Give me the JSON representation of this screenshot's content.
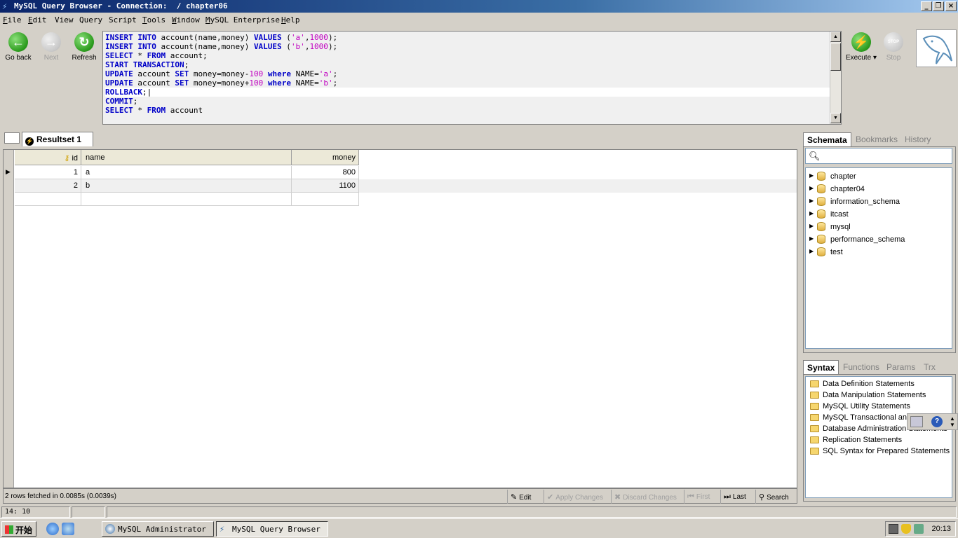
{
  "window": {
    "title": "MySQL Query Browser - Connection:  / chapter06"
  },
  "menu": {
    "items": [
      {
        "ul": "F",
        "rest": "ile"
      },
      {
        "ul": "E",
        "rest": "dit"
      },
      {
        "ul": "",
        "rest": "View"
      },
      {
        "ul": "",
        "rest": "Query"
      },
      {
        "ul": "",
        "rest": "Script"
      },
      {
        "ul": "T",
        "rest": "ools"
      },
      {
        "ul": "W",
        "rest": "indow"
      },
      {
        "ul": "M",
        "rest": "ySQL Enterprise"
      },
      {
        "ul": "H",
        "rest": "elp"
      }
    ]
  },
  "toolbar": {
    "go_back": "Go back",
    "next": "Next",
    "refresh": "Refresh",
    "execute": "Execute",
    "stop": "Stop"
  },
  "editor": {
    "lines": [
      [
        [
          "kw",
          "INSERT INTO"
        ],
        [
          "t",
          " account(name,money) "
        ],
        [
          "kw",
          "VALUES"
        ],
        [
          "t",
          " ("
        ],
        [
          "str",
          "'a'"
        ],
        [
          "t",
          ","
        ],
        [
          "num",
          "1000"
        ],
        [
          "t",
          ");"
        ]
      ],
      [
        [
          "kw",
          "INSERT INTO"
        ],
        [
          "t",
          " account(name,money) "
        ],
        [
          "kw",
          "VALUES"
        ],
        [
          "t",
          " ("
        ],
        [
          "str",
          "'b'"
        ],
        [
          "t",
          ","
        ],
        [
          "num",
          "1000"
        ],
        [
          "t",
          ");"
        ]
      ],
      [
        [
          "kw",
          "SELECT"
        ],
        [
          "t",
          " * "
        ],
        [
          "kw",
          "FROM"
        ],
        [
          "t",
          " account;"
        ]
      ],
      [
        [
          "kw",
          "START TRANSACTION"
        ],
        [
          "t",
          ";"
        ]
      ],
      [
        [
          "kw",
          "UPDATE"
        ],
        [
          "t",
          " account "
        ],
        [
          "kw",
          "SET"
        ],
        [
          "t",
          " money=money-"
        ],
        [
          "num",
          "100"
        ],
        [
          "t",
          " "
        ],
        [
          "kw",
          "where"
        ],
        [
          "t",
          " NAME="
        ],
        [
          "str",
          "'a'"
        ],
        [
          "t",
          ";"
        ]
      ],
      [
        [
          "kw",
          "UPDATE"
        ],
        [
          "t",
          " account "
        ],
        [
          "kw",
          "SET"
        ],
        [
          "t",
          " money=money+"
        ],
        [
          "num",
          "100"
        ],
        [
          "t",
          " "
        ],
        [
          "kw",
          "where"
        ],
        [
          "t",
          " NAME="
        ],
        [
          "str",
          "'b'"
        ],
        [
          "t",
          ";"
        ]
      ],
      [
        [
          "kw",
          "ROLLBACK"
        ],
        [
          "t",
          ";|"
        ]
      ],
      [
        [
          "kw",
          "COMMIT"
        ],
        [
          "t",
          ";"
        ]
      ],
      [
        [
          "kw",
          "SELECT"
        ],
        [
          "t",
          " * "
        ],
        [
          "kw",
          "FROM"
        ],
        [
          "t",
          " account"
        ]
      ]
    ],
    "current_line": 6
  },
  "results": {
    "tab_label": "Resultset 1",
    "columns": [
      {
        "label": "id",
        "align": "right",
        "key": true
      },
      {
        "label": "name",
        "align": "left"
      },
      {
        "label": "money",
        "align": "right"
      }
    ],
    "rows": [
      [
        "1",
        "a",
        "800"
      ],
      [
        "2",
        "b",
        "1100"
      ]
    ],
    "status": "2 rows fetched in 0.0085s (0.0039s)",
    "buttons": {
      "edit": "Edit",
      "apply": "Apply Changes",
      "discard": "Discard Changes",
      "first": "First",
      "last": "Last",
      "search": "Search"
    }
  },
  "schemata": {
    "tabs": [
      "Schemata",
      "Bookmarks",
      "History"
    ],
    "search_placeholder": "",
    "items": [
      "chapter",
      "chapter04",
      "information_schema",
      "itcast",
      "mysql",
      "performance_schema",
      "test"
    ]
  },
  "syntax": {
    "tabs": [
      "Syntax",
      "Functions",
      "Params",
      "Trx"
    ],
    "items": [
      "Data Definition Statements",
      "Data Manipulation Statements",
      "MySQL Utility Statements",
      "MySQL Transactional and",
      "Database Administration Statements",
      "Replication Statements",
      "SQL Syntax for Prepared Statements"
    ]
  },
  "statusbar": {
    "cursor": "14: 10"
  },
  "taskbar": {
    "start": "开始",
    "apps": [
      "MySQL Administrator",
      "MySQL Query Browser"
    ],
    "clock": "20:13"
  },
  "colors": {
    "keyword": "#0000c8",
    "string": "#c000c0",
    "title_gradient_start": "#0a246a",
    "exec_green": "#2a9a1c"
  }
}
